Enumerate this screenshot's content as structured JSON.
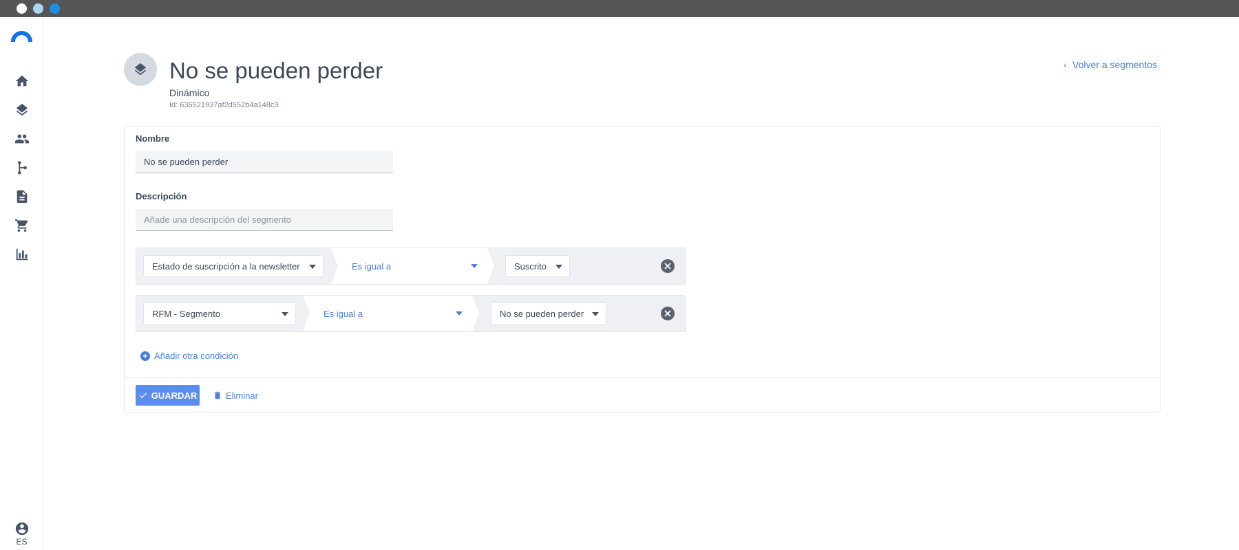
{
  "window": {
    "controls": [
      "close",
      "minimize",
      "maximize"
    ]
  },
  "sidebar": {
    "logo": "brand-logo",
    "items": [
      {
        "name": "home",
        "icon": "home-icon"
      },
      {
        "name": "segments",
        "icon": "layers-icon"
      },
      {
        "name": "contacts",
        "icon": "people-icon"
      },
      {
        "name": "flows",
        "icon": "flow-icon"
      },
      {
        "name": "templates",
        "icon": "document-icon"
      },
      {
        "name": "ecommerce",
        "icon": "cart-icon"
      },
      {
        "name": "reports",
        "icon": "bar-chart-icon"
      }
    ],
    "user_icon": "account-circle-icon",
    "language": "ES"
  },
  "header": {
    "icon": "layers-icon",
    "title": "No se pueden perder",
    "type": "Dinámico",
    "id_text": "Id: 636521937af2d552b4a148c3",
    "back_link": "Volver a segmentos"
  },
  "form": {
    "name_label": "Nombre",
    "name_value": "No se pueden perder",
    "description_label": "Descripción",
    "description_placeholder": "Añade una descripción del segmento",
    "description_value": ""
  },
  "conditions": [
    {
      "field": "Estado de suscripción a la newsletter",
      "operator": "Es igual a",
      "value": "Suscrito"
    },
    {
      "field": "RFM - Segmento",
      "operator": "Es igual a",
      "value": "No se pueden perder"
    }
  ],
  "add_condition_label": "Añadir otra condición",
  "actions": {
    "save_label": "GUARDAR",
    "delete_label": "Eliminar"
  },
  "colors": {
    "accent": "#4a7fdc",
    "save_button": "#5b8def",
    "brand": "#1473e6",
    "titlebar": "#555555"
  }
}
